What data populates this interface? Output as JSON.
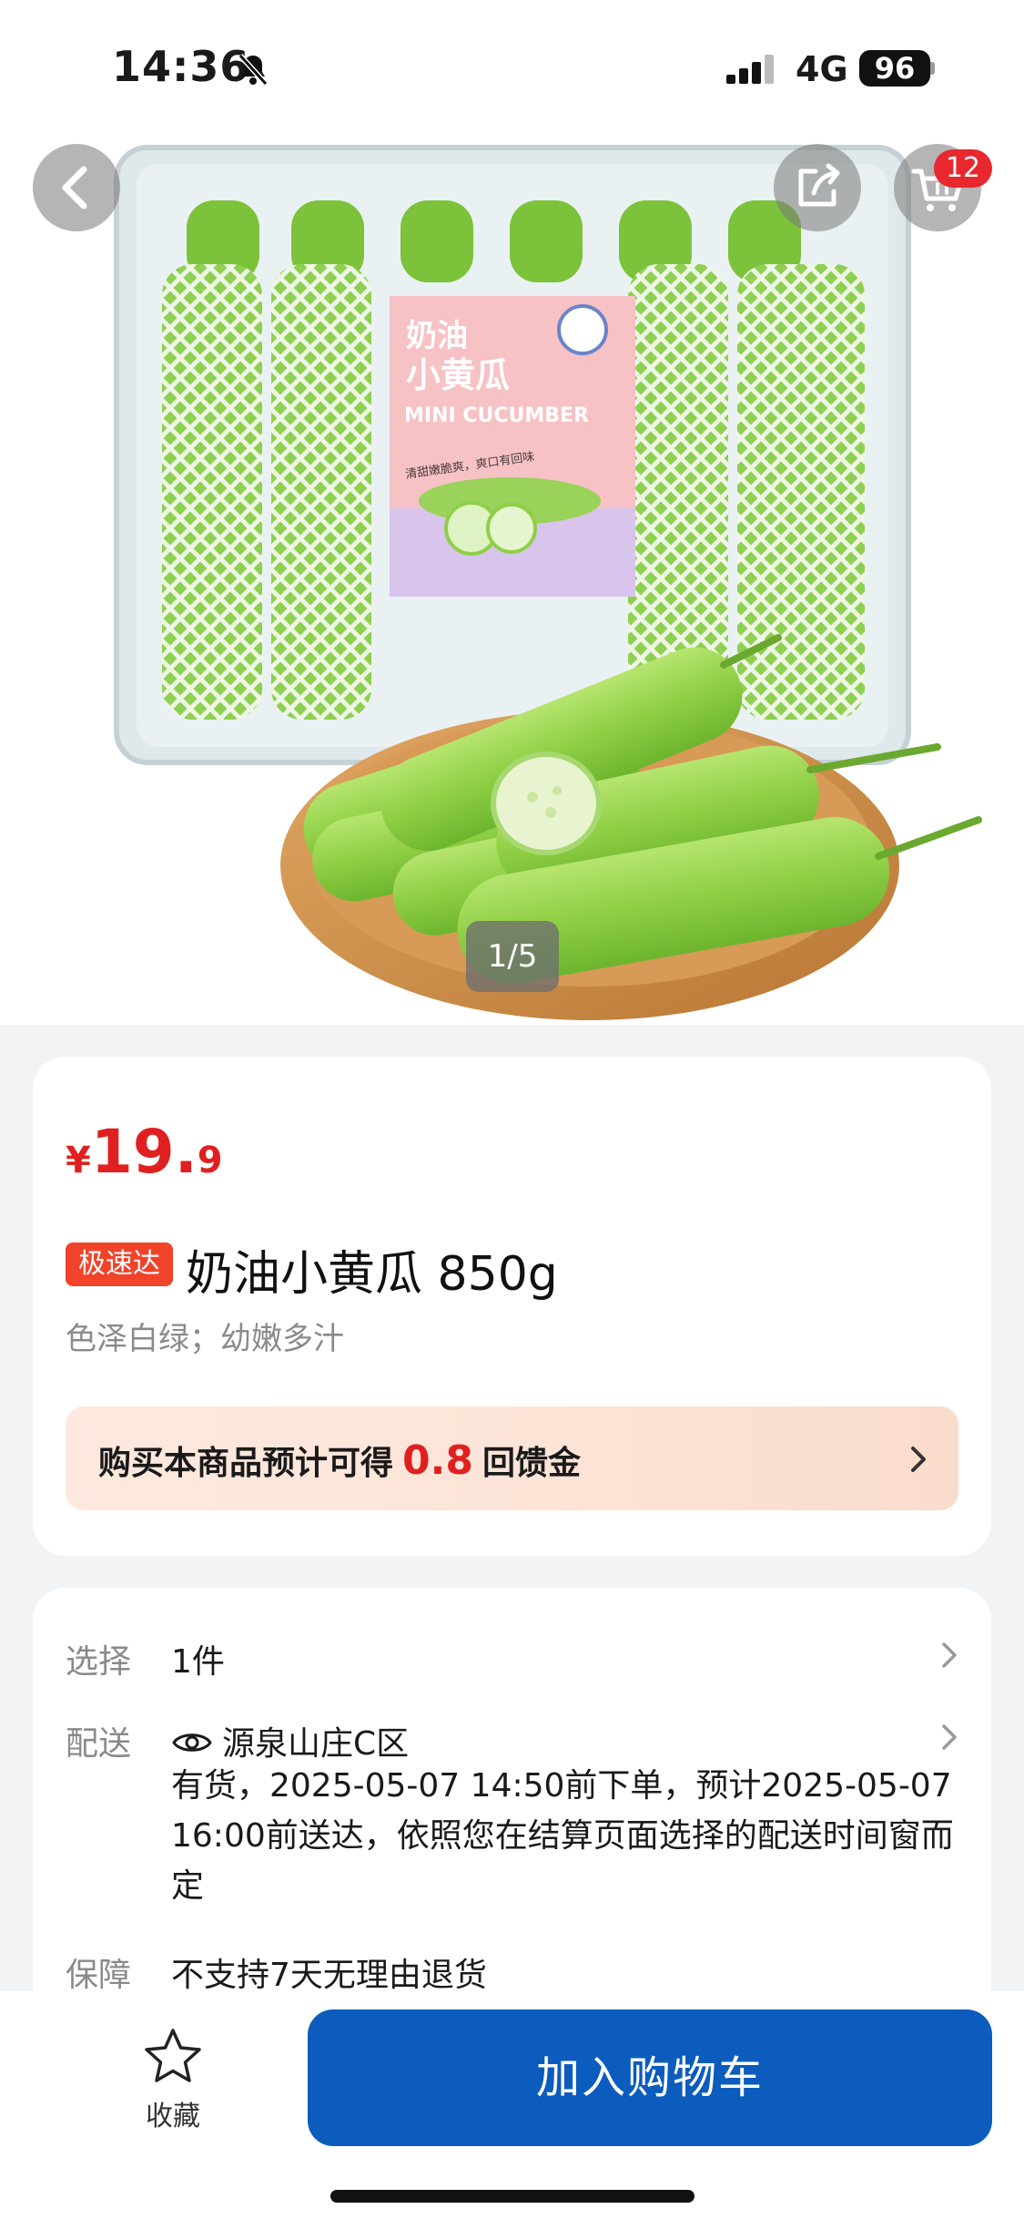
{
  "status_bar": {
    "time": "14:36",
    "network": "4G",
    "battery": "96",
    "icons": [
      "bell-slash-icon",
      "signal-icon"
    ]
  },
  "hero": {
    "pager": "1/5",
    "cart_count": "12",
    "package_label": {
      "line1": "奶油",
      "line2": "小黄瓜",
      "english": "MINI CUCUMBER",
      "slogan": "清甜嫩脆爽，爽口有回味"
    },
    "icons": [
      "back-arrow-icon",
      "share-icon",
      "cart-icon"
    ]
  },
  "product": {
    "currency": "¥",
    "price_int": "19.",
    "price_dec": "9",
    "badge": "极速达",
    "title": "奶油小黄瓜 850g",
    "subtitle": "色泽白绿；幼嫩多汁",
    "rebate": {
      "prefix": "购买本商品预计可得",
      "amount": "0.8",
      "suffix": "回馈金"
    }
  },
  "info": {
    "select_label": "选择",
    "select_value": "1件",
    "delivery_label": "配送",
    "delivery_address": "源泉山庄C区",
    "delivery_detail": "有货，2025-05-07 14:50前下单，预计2025-05-07 16:00前送达，依照您在结算页面选择的配送时间窗而定",
    "guarantee_label": "保障",
    "guarantee_value": "不支持7天无理由退货"
  },
  "bottom_bar": {
    "favorite_label": "收藏",
    "add_to_cart": "加入购物车"
  },
  "colors": {
    "price_red": "#e02020",
    "badge_orange": "#f0432a",
    "primary_blue": "#0b5cbd",
    "page_bg": "#f2f3f5"
  }
}
